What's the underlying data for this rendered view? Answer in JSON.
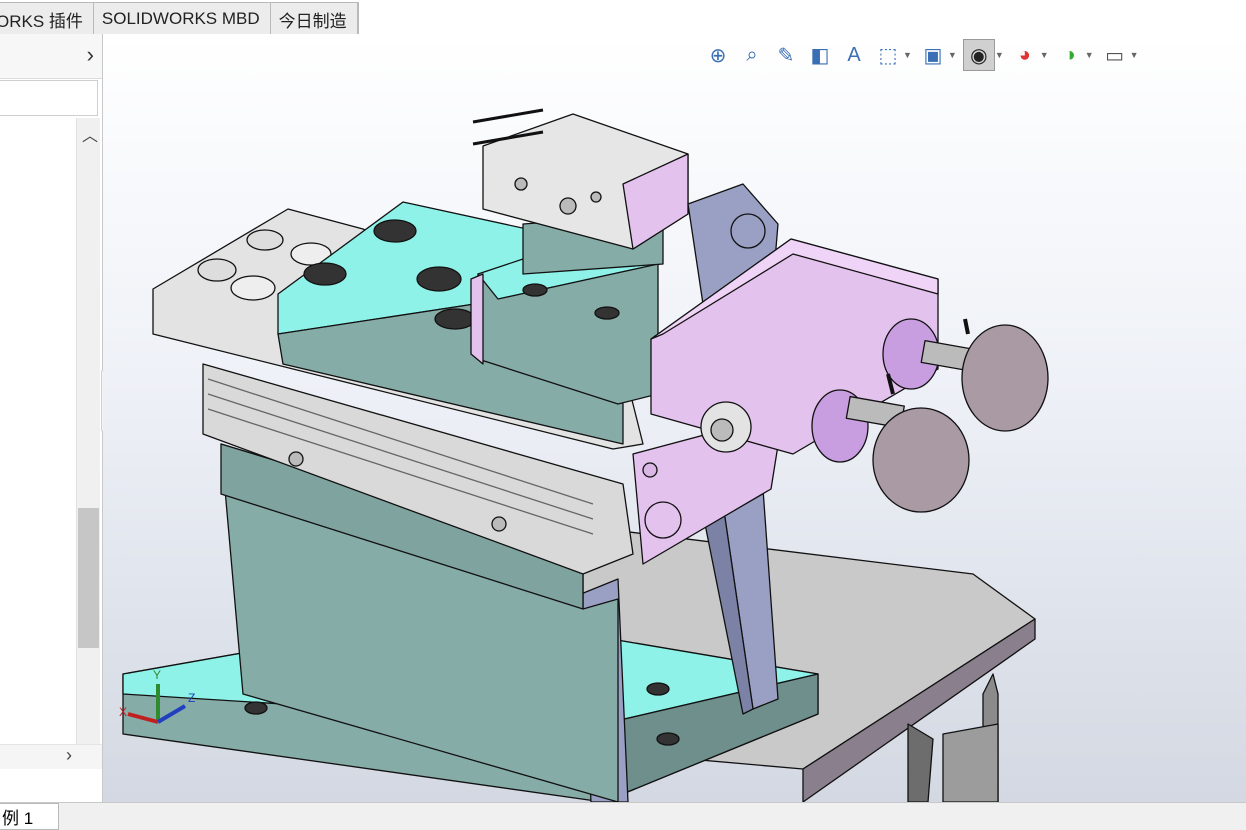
{
  "tabs": [
    {
      "label": "ORKS 插件"
    },
    {
      "label": "SOLIDWORKS MBD"
    },
    {
      "label": "今日制造"
    }
  ],
  "left_panel": {
    "expand_icon": "chevron-right-icon",
    "scroll_up_icon": "chevron-up-icon",
    "scroll_down_icon": "chevron-down-icon",
    "scroll_right_icon": "chevron-right-icon"
  },
  "heads_up_toolbar": [
    {
      "name": "zoom-to-fit-icon",
      "glyph": "⌕"
    },
    {
      "name": "zoom-to-area-icon",
      "glyph": "🔍"
    },
    {
      "name": "previous-view-icon",
      "glyph": "↶"
    },
    {
      "name": "section-view-icon",
      "glyph": "◧"
    },
    {
      "name": "dynamic-annotation-icon",
      "glyph": "A"
    },
    {
      "name": "view-orientation-icon",
      "glyph": "⬚"
    },
    {
      "name": "display-style-icon",
      "glyph": "▣"
    },
    {
      "name": "hide-show-items-icon",
      "glyph": "👁"
    },
    {
      "name": "edit-appearance-icon",
      "glyph": "◕"
    },
    {
      "name": "apply-scene-icon",
      "glyph": "◑"
    },
    {
      "name": "view-settings-icon",
      "glyph": "▭"
    }
  ],
  "triad": {
    "x_label": "X",
    "y_label": "Y",
    "z_label": "Z"
  },
  "bottom": {
    "sheet_tab": "例 1"
  },
  "colors": {
    "teal_part": "#86aca8",
    "cyan_face": "#8ff2e9",
    "pink_part": "#e4c2ee",
    "lavender_part": "#9aa0c4",
    "gray_plate": "#a79aa7",
    "knob": "#a99aa4",
    "steel": "#d9d9d9"
  }
}
